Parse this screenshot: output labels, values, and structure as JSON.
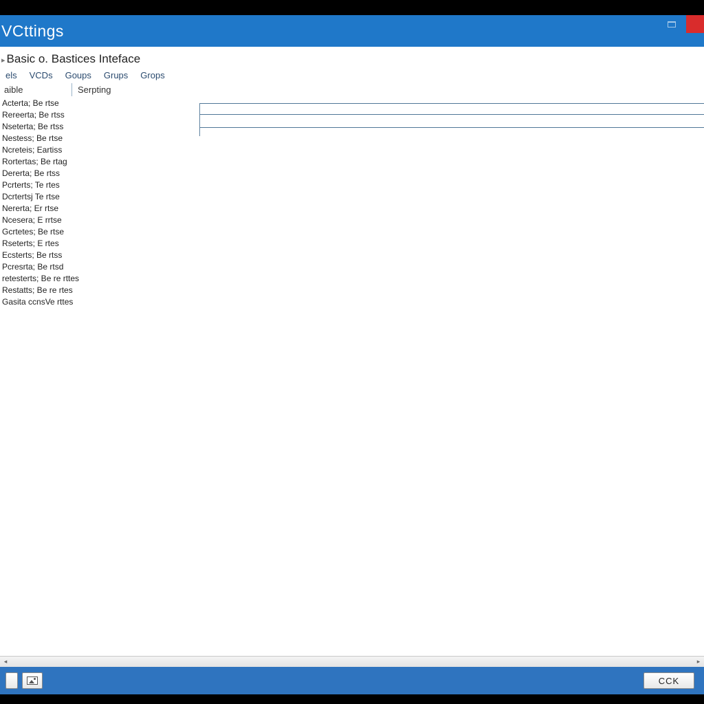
{
  "window": {
    "title": "VCttings"
  },
  "header": {
    "line": "Basic o. Bastices Inteface"
  },
  "tabs": [
    "els",
    "VCDs",
    "Goups",
    "Grups",
    "Grops"
  ],
  "subrow": {
    "left": "aible",
    "right": "Serpting"
  },
  "sidebar": {
    "items": [
      "Acterta; Be rtse",
      "Rereerta; Be rtss",
      "Nseterta; Be rtss",
      "Nestess; Be rtse",
      "Ncreteis; Eartiss",
      "Rortertas; Be rtag",
      "Dererta; Be rtss",
      "Pcrterts; Te rtes",
      "Dcrtertsj Te rtse",
      "Nererta; Er rtse",
      "Ncesera; E rrtse",
      "Gcrtetes; Be rtse",
      "Rseterts; E rtes",
      "Ecsterts; Be rtss",
      "Pcresrta; Be rtsd",
      "retesterts; Be re rttes",
      "Restatts; Be re rtes",
      "Gasita ccnsVe rttes"
    ]
  },
  "footer": {
    "ok_label": "CCK"
  }
}
